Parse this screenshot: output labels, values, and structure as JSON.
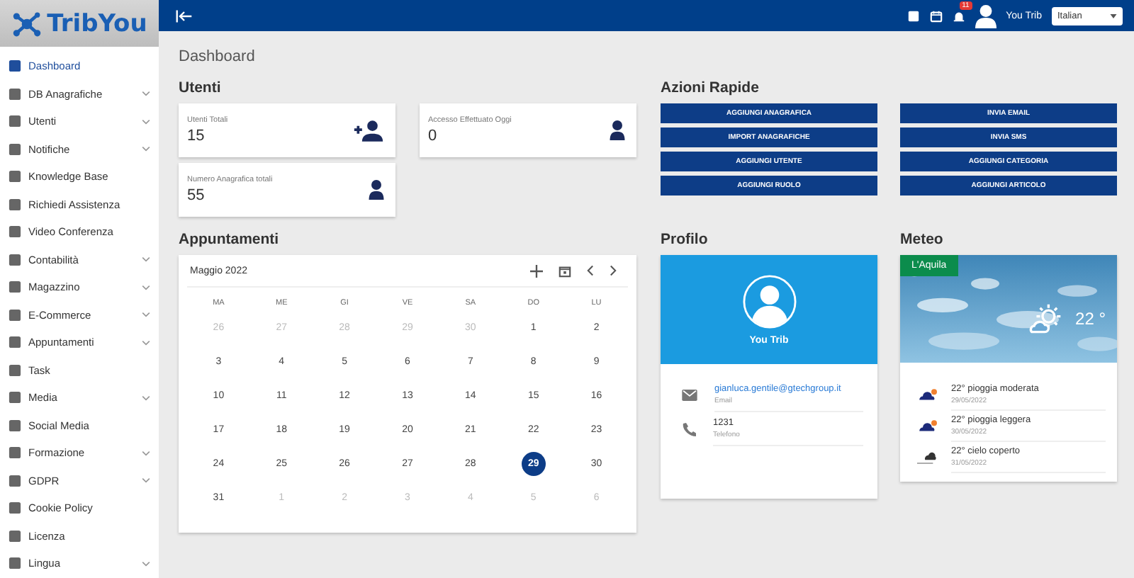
{
  "logo": {
    "text": "TribYou"
  },
  "sidebar": {
    "items": [
      {
        "label": "Dashboard",
        "selected": true,
        "expandable": false
      },
      {
        "label": "DB Anagrafiche",
        "selected": false,
        "expandable": true
      },
      {
        "label": "Utenti",
        "selected": false,
        "expandable": true
      },
      {
        "label": "Notifiche",
        "selected": false,
        "expandable": true
      },
      {
        "label": "Knowledge Base",
        "selected": false,
        "expandable": false
      },
      {
        "label": "Richiedi Assistenza",
        "selected": false,
        "expandable": false
      },
      {
        "label": "Video Conferenza",
        "selected": false,
        "expandable": false
      },
      {
        "label": "Contabilità",
        "selected": false,
        "expandable": true
      },
      {
        "label": "Magazzino",
        "selected": false,
        "expandable": true
      },
      {
        "label": "E-Commerce",
        "selected": false,
        "expandable": true
      },
      {
        "label": "Appuntamenti",
        "selected": false,
        "expandable": true
      },
      {
        "label": "Task",
        "selected": false,
        "expandable": false
      },
      {
        "label": "Media",
        "selected": false,
        "expandable": true
      },
      {
        "label": "Social Media",
        "selected": false,
        "expandable": false
      },
      {
        "label": "Formazione",
        "selected": false,
        "expandable": true
      },
      {
        "label": "GDPR",
        "selected": false,
        "expandable": true
      },
      {
        "label": "Cookie Policy",
        "selected": false,
        "expandable": false
      },
      {
        "label": "Licenza",
        "selected": false,
        "expandable": false
      },
      {
        "label": "Lingua",
        "selected": false,
        "expandable": true
      }
    ]
  },
  "topbar": {
    "notification_count": "11",
    "user": "You Trib",
    "language": "Italian"
  },
  "page_title": "Dashboard",
  "utenti": {
    "title": "Utenti",
    "cards": [
      {
        "label": "Utenti Totali",
        "value": "15",
        "kind": "add"
      },
      {
        "label": "Accesso Effettuato Oggi",
        "value": "0",
        "kind": "person"
      },
      {
        "label": "Numero Anagrafica totali",
        "value": "55",
        "kind": "person"
      }
    ]
  },
  "azioni_rapide": {
    "title": "Azioni Rapide",
    "buttons": [
      "AGGIUNGI ANAGRAFICA",
      "INVIA EMAIL",
      "IMPORT ANAGRAFICHE",
      "INVIA SMS",
      "AGGIUNGI UTENTE",
      "AGGIUNGI CATEGORIA",
      "AGGIUNGI RUOLO",
      "AGGIUNGI ARTICOLO"
    ]
  },
  "appuntamenti": {
    "title": "Appuntamenti",
    "month": "Maggio 2022",
    "weekdays": [
      "MA",
      "ME",
      "GI",
      "VE",
      "SA",
      "DO",
      "LU"
    ],
    "weeks": [
      [
        {
          "day": "26",
          "muted": true,
          "selected": false
        },
        {
          "day": "27",
          "muted": true,
          "selected": false
        },
        {
          "day": "28",
          "muted": true,
          "selected": false
        },
        {
          "day": "29",
          "muted": true,
          "selected": false
        },
        {
          "day": "30",
          "muted": true,
          "selected": false
        },
        {
          "day": "1",
          "muted": false,
          "selected": false
        },
        {
          "day": "2",
          "muted": false,
          "selected": false
        }
      ],
      [
        {
          "day": "3",
          "muted": false,
          "selected": false
        },
        {
          "day": "4",
          "muted": false,
          "selected": false
        },
        {
          "day": "5",
          "muted": false,
          "selected": false
        },
        {
          "day": "6",
          "muted": false,
          "selected": false
        },
        {
          "day": "7",
          "muted": false,
          "selected": false
        },
        {
          "day": "8",
          "muted": false,
          "selected": false
        },
        {
          "day": "9",
          "muted": false,
          "selected": false
        }
      ],
      [
        {
          "day": "10",
          "muted": false,
          "selected": false
        },
        {
          "day": "11",
          "muted": false,
          "selected": false
        },
        {
          "day": "12",
          "muted": false,
          "selected": false
        },
        {
          "day": "13",
          "muted": false,
          "selected": false
        },
        {
          "day": "14",
          "muted": false,
          "selected": false
        },
        {
          "day": "15",
          "muted": false,
          "selected": false
        },
        {
          "day": "16",
          "muted": false,
          "selected": false
        }
      ],
      [
        {
          "day": "17",
          "muted": false,
          "selected": false
        },
        {
          "day": "18",
          "muted": false,
          "selected": false
        },
        {
          "day": "19",
          "muted": false,
          "selected": false
        },
        {
          "day": "20",
          "muted": false,
          "selected": false
        },
        {
          "day": "21",
          "muted": false,
          "selected": false
        },
        {
          "day": "22",
          "muted": false,
          "selected": false
        },
        {
          "day": "23",
          "muted": false,
          "selected": false
        }
      ],
      [
        {
          "day": "24",
          "muted": false,
          "selected": false
        },
        {
          "day": "25",
          "muted": false,
          "selected": false
        },
        {
          "day": "26",
          "muted": false,
          "selected": false
        },
        {
          "day": "27",
          "muted": false,
          "selected": false
        },
        {
          "day": "28",
          "muted": false,
          "selected": false
        },
        {
          "day": "29",
          "muted": false,
          "selected": true
        },
        {
          "day": "30",
          "muted": false,
          "selected": false
        }
      ],
      [
        {
          "day": "31",
          "muted": false,
          "selected": false
        },
        {
          "day": "1",
          "muted": true,
          "selected": false
        },
        {
          "day": "2",
          "muted": true,
          "selected": false
        },
        {
          "day": "3",
          "muted": true,
          "selected": false
        },
        {
          "day": "4",
          "muted": true,
          "selected": false
        },
        {
          "day": "5",
          "muted": true,
          "selected": false
        },
        {
          "day": "6",
          "muted": true,
          "selected": false
        }
      ]
    ]
  },
  "profilo": {
    "title": "Profilo",
    "name": "You Trib",
    "rows": [
      {
        "kind": "email",
        "value": "gianluca.gentile@gtechgroup.it",
        "label": "Email"
      },
      {
        "kind": "phone",
        "value": "1231",
        "label": "Telefono"
      }
    ]
  },
  "meteo": {
    "title": "Meteo",
    "city": "L'Aquila",
    "temperature": "22 °",
    "forecast": [
      {
        "kind": "rain",
        "text": "22° pioggia moderata",
        "date": "29/05/2022"
      },
      {
        "kind": "rain",
        "text": "22° pioggia leggera",
        "date": "30/05/2022"
      },
      {
        "kind": "cloud",
        "text": "22° cielo coperto",
        "date": "31/05/2022"
      }
    ]
  }
}
